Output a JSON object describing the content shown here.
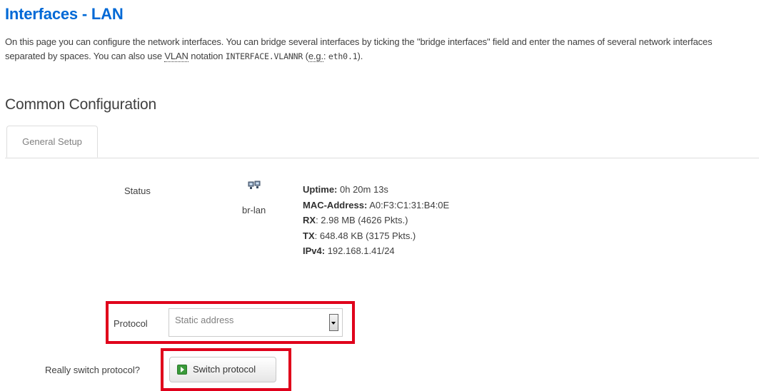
{
  "page": {
    "title": "Interfaces - LAN",
    "description": {
      "part1": "On this page you can configure the network interfaces. You can bridge several interfaces by ticking the \"bridge interfaces\" field and enter the names of several network interfaces separated by spaces. You can also use ",
      "vlan_abbr": "VLAN",
      "part2": " notation ",
      "interface_notation": "INTERFACE.VLANNR",
      "part3": " (",
      "eg_abbr": "e.g.",
      "part4": ": ",
      "example": "eth0.1",
      "part5": ")."
    }
  },
  "section": {
    "title": "Common Configuration",
    "tabs": [
      {
        "label": "General Setup",
        "active": true
      }
    ]
  },
  "status": {
    "label": "Status",
    "interface_icon": "network-bridge-icon",
    "interface_name": "br-lan",
    "uptime_label": "Uptime:",
    "uptime_value": " 0h 20m 13s",
    "mac_label": "MAC-Address:",
    "mac_value": " A0:F3:C1:31:B4:0E",
    "rx_label": "RX",
    "rx_value": ": 2.98 MB (4626 Pkts.)",
    "tx_label": "TX",
    "tx_value": ": 648.48 KB (3175 Pkts.)",
    "ipv4_label": "IPv4:",
    "ipv4_value": " 192.168.1.41/24"
  },
  "protocol": {
    "label": "Protocol",
    "selected": "Static address"
  },
  "switch_protocol": {
    "label": "Really switch protocol?",
    "button_label": "Switch protocol",
    "button_icon": "play-icon"
  },
  "colors": {
    "title": "#0069d6",
    "highlight": "#e0001b"
  }
}
